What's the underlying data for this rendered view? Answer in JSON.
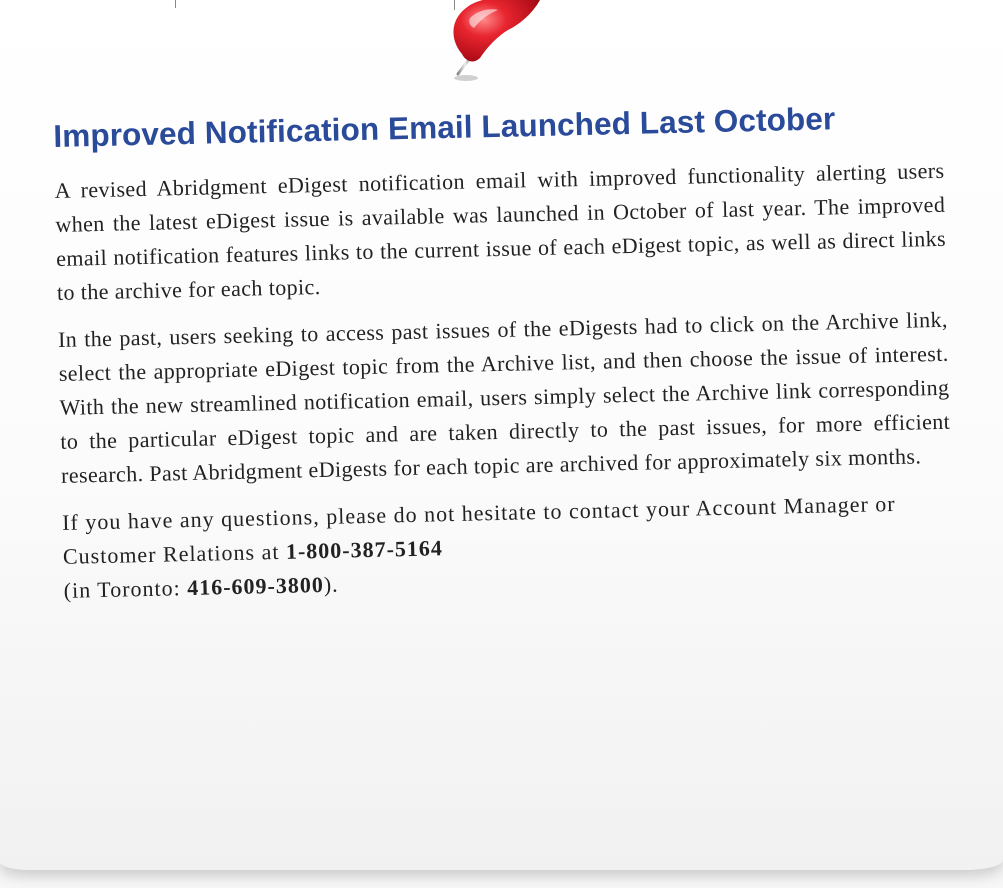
{
  "article": {
    "title": "Improved Notification Email Launched Last October",
    "paragraph1": "A revised Abridgment eDigest notification email with improved functionality alerting users when the latest eDigest issue is available was launched in October of last year. The improved email notification features links to the current issue of each eDigest topic, as well as direct links to the archive for each topic.",
    "paragraph2": "In the past, users seeking to access past issues of the eDigests had to click on the Archive link, select the appropriate eDigest topic from the Archive list, and then choose the issue of interest. With the new streamlined notification email, users simply select the Archive link corresponding to the particular eDigest topic and are taken directly to the past issues, for more efficient research. Past Abridgment eDigests for each topic are archived for approximately six months.",
    "contact": {
      "text_before": "If you have any questions, please do not hesitate to contact your Account Manager or Customer Relations at ",
      "phone_main": "1-800-387-5164",
      "text_middle": "(in Toronto: ",
      "phone_toronto": "416-609-3800",
      "text_after": ")."
    }
  },
  "colors": {
    "title": "#2a4a9a",
    "body_text": "#222222",
    "pin": "#d81e2c"
  },
  "icons": {
    "pin": "push-pin-icon"
  }
}
